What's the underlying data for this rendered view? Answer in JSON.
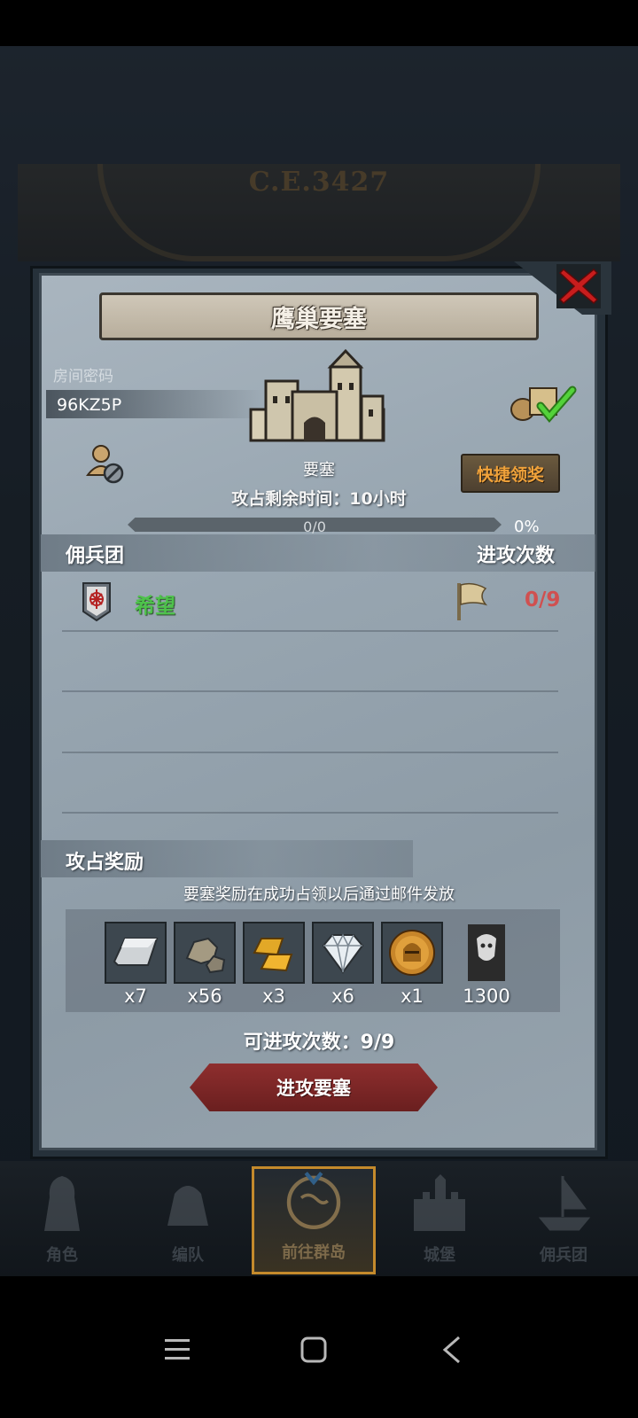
{
  "background": {
    "era_label": "C.E.3427"
  },
  "dialog": {
    "title": "鹰巢要塞",
    "room_code_label": "房间密码",
    "room_code": "96KZ5P",
    "fortress_label": "要塞",
    "timer_text": "攻占剩余时间：10小时",
    "progress": {
      "text": "0/0",
      "percent_text": "0%",
      "fill_fraction": 0.0
    },
    "quick_claim_label": "快捷领奖"
  },
  "mercenary_section": {
    "left_header": "佣兵团",
    "right_header": "进攻次数",
    "rows": [
      {
        "name": "希望",
        "attacks": "0/9"
      }
    ]
  },
  "reward_section": {
    "title": "攻占奖励",
    "note": "要塞奖励在成功占领以后通过邮件发放",
    "items": [
      {
        "icon": "silver-ingot-icon",
        "qty": "x7"
      },
      {
        "icon": "ore-rock-icon",
        "qty": "x56"
      },
      {
        "icon": "gold-bars-icon",
        "qty": "x3"
      },
      {
        "icon": "diamond-icon",
        "qty": "x6"
      },
      {
        "icon": "helmet-coin-icon",
        "qty": "x1"
      },
      {
        "icon": "banner-icon",
        "qty": "1300"
      }
    ],
    "attempts_text": "可进攻次数：9/9",
    "attack_button_label": "进攻要塞"
  },
  "bottom_nav": [
    {
      "label": "角色",
      "icon": "knight-icon"
    },
    {
      "label": "编队",
      "icon": "formation-helmet-icon"
    },
    {
      "label": "前往群岛",
      "icon": "globe-compass-icon",
      "active": true
    },
    {
      "label": "城堡",
      "icon": "castle-icon"
    },
    {
      "label": "佣兵团",
      "icon": "mercenary-ship-icon"
    }
  ],
  "colors": {
    "accent_gold": "#c48a2c",
    "merc_name_green": "#4ec24b",
    "attack_count_red": "#d05050",
    "quick_claim_orange": "#f0a23a",
    "attack_button_red": "#8e2e2e"
  }
}
